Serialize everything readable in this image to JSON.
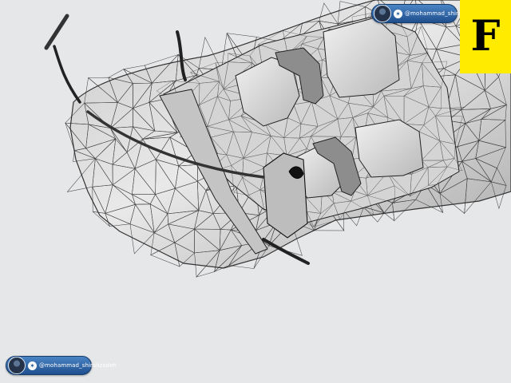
{
  "watermark": {
    "handle": "@mohammad_shiralizadeh",
    "icon": "twitter-bird-icon"
  },
  "level_tile": {
    "letter": "F",
    "color": "#ffeb00"
  },
  "colors": {
    "background": "#e6e7e9",
    "mesh_fill": "#dcdcdc",
    "mesh_line": "#2a2a2a"
  }
}
